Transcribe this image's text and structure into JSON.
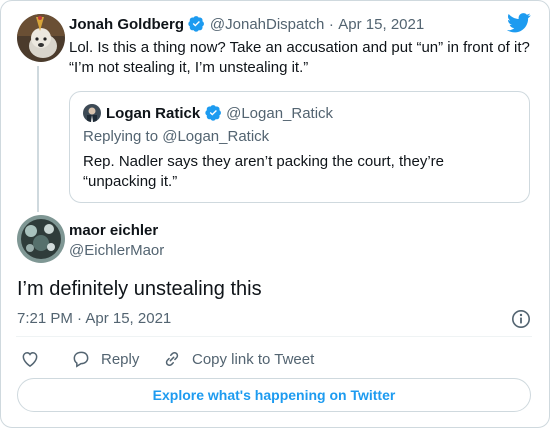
{
  "parent_tweet": {
    "author_name": "Jonah Goldberg",
    "handle": "@JonahDispatch",
    "separator": "·",
    "date": "Apr 15, 2021",
    "text_line1": "Lol. Is this a thing now? Take an accusation and put “un” in front of it?",
    "text_line2": "“I’m not stealing it, I’m unstealing it.”"
  },
  "quoted_tweet": {
    "author_name": "Logan Ratick",
    "handle": "@Logan_Ratick",
    "replying_to": "Replying to @Logan_Ratick",
    "text_line1": "Rep. Nadler says they aren’t packing the court, they’re",
    "text_line2": "“unpacking it.”"
  },
  "main_tweet": {
    "author_name": "maor eichler",
    "handle": "@EichlerMaor",
    "text": "I’m definitely unstealing this",
    "time": "7:21 PM · Apr 15, 2021"
  },
  "actions": {
    "reply_label": "Reply",
    "copy_link_label": "Copy link to Tweet"
  },
  "explore_label": "Explore what's happening on Twitter",
  "colors": {
    "accent": "#1d9bf0",
    "muted_text": "#536471",
    "border": "#cfd9de"
  }
}
